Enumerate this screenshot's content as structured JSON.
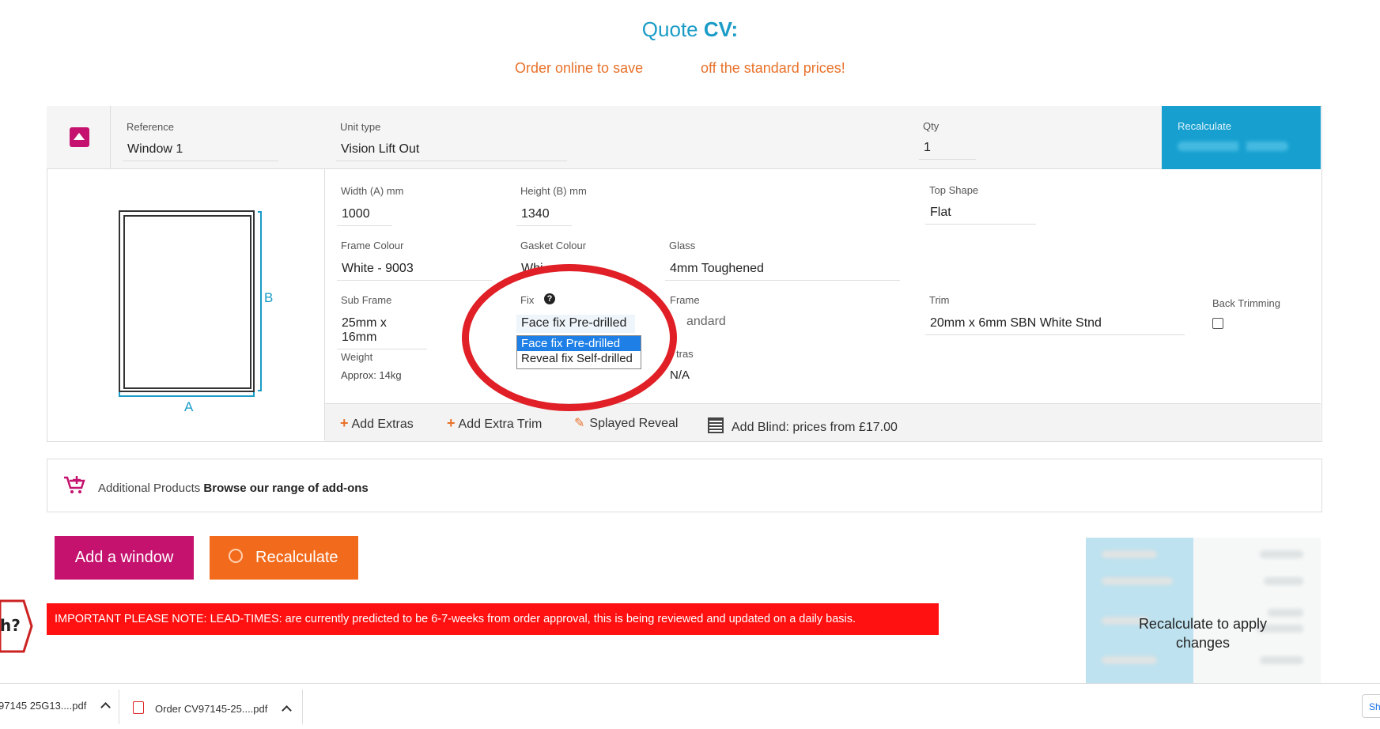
{
  "header": {
    "title_prefix": "Quote",
    "title_code": "CV:",
    "promo_left": "Order online to save",
    "promo_right": "off the standard prices!"
  },
  "item": {
    "reference_label": "Reference",
    "reference_value": "Window 1",
    "unit_type_label": "Unit type",
    "unit_type_value": "Vision Lift Out",
    "qty_label": "Qty",
    "qty_value": "1",
    "recalculate_label": "Recalculate"
  },
  "diagram": {
    "dim_a": "A",
    "dim_b": "B"
  },
  "fields": {
    "width_label": "Width (A) mm",
    "width_value": "1000",
    "height_label": "Height (B) mm",
    "height_value": "1340",
    "top_shape_label": "Top Shape",
    "top_shape_value": "Flat",
    "frame_colour_label": "Frame Colour",
    "frame_colour_value": "White - 9003",
    "gasket_colour_label": "Gasket Colour",
    "gasket_colour_value": "Whi",
    "glass_label": "Glass",
    "glass_value": "4mm Toughened",
    "sub_frame_label": "Sub Frame",
    "sub_frame_value": "25mm x 16mm",
    "fix_label": "Fix",
    "fix_value": "Face fix Pre-drilled",
    "frame_label": "Frame",
    "frame_value": "andard",
    "trim_label": "Trim",
    "trim_value": "20mm x 6mm SBN White Stnd",
    "back_trimming_label": "Back Trimming",
    "weight_label": "Weight",
    "weight_value": "Approx: 14kg",
    "extras_label": "tras",
    "extras_value": "N/A"
  },
  "fix_dropdown": {
    "options": [
      "Face fix Pre-drilled",
      "Reveal fix Self-drilled"
    ]
  },
  "extras_bar": {
    "add_extras": "Add Extras",
    "add_extra_trim": "Add Extra Trim",
    "splayed_reveal": "Splayed Reveal",
    "add_blind": "Add Blind: prices from £17.00"
  },
  "additional": {
    "label": "Additional Products",
    "link": "Browse our range of add-ons"
  },
  "actions": {
    "add_window": "Add a window",
    "recalculate": "Recalculate"
  },
  "notice": "IMPORTANT PLEASE NOTE: LEAD-TIMES: are currently predicted to be 6-7-weeks from order approval, this is being reviewed and updated on a daily basis.",
  "summary": {
    "message": "Recalculate to apply changes"
  },
  "downloads": {
    "item1": "97145 25G13....pdf",
    "item2": "Order CV97145-25....pdf",
    "show_all": "Sh"
  },
  "colors": {
    "brand_blue": "#1a9cc7",
    "brand_magenta": "#c5126e",
    "brand_orange": "#f26b1d",
    "notice_red": "#ff1111",
    "annotation_red": "#e01f26"
  }
}
